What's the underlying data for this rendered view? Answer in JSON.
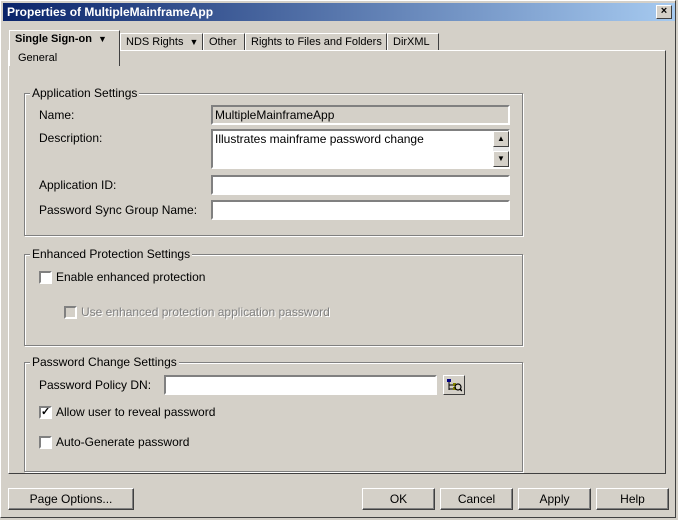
{
  "window": {
    "title": "Properties of MultipleMainframeApp",
    "close_label": "×"
  },
  "tabs": [
    {
      "label": "Single Sign-on",
      "active": true,
      "has_dropdown": true,
      "sub_label": "General"
    },
    {
      "label": "NDS Rights",
      "has_dropdown": true
    },
    {
      "label": "Other"
    },
    {
      "label": "Rights to Files and Folders"
    },
    {
      "label": "DirXML"
    }
  ],
  "app_settings": {
    "group_label": "Application Settings",
    "name_label": "Name:",
    "name_value": "MultipleMainframeApp",
    "description_label": "Description:",
    "description_value": "Illustrates mainframe password change",
    "app_id_label": "Application ID:",
    "app_id_value": "",
    "sync_group_label": "Password Sync Group Name:",
    "sync_group_value": ""
  },
  "enhanced": {
    "group_label": "Enhanced Protection Settings",
    "enable_label": "Enable enhanced protection",
    "enable_checked": false,
    "use_password_label": "Use enhanced protection application password",
    "use_password_checked": false
  },
  "password_change": {
    "group_label": "Password Change Settings",
    "policy_dn_label": "Password Policy DN:",
    "policy_dn_value": "",
    "reveal_label": "Allow user to reveal password",
    "reveal_checked": true,
    "autogen_label": "Auto-Generate password",
    "autogen_checked": false
  },
  "footer": {
    "page_options": "Page Options...",
    "ok": "OK",
    "cancel": "Cancel",
    "apply": "Apply",
    "help": "Help"
  }
}
